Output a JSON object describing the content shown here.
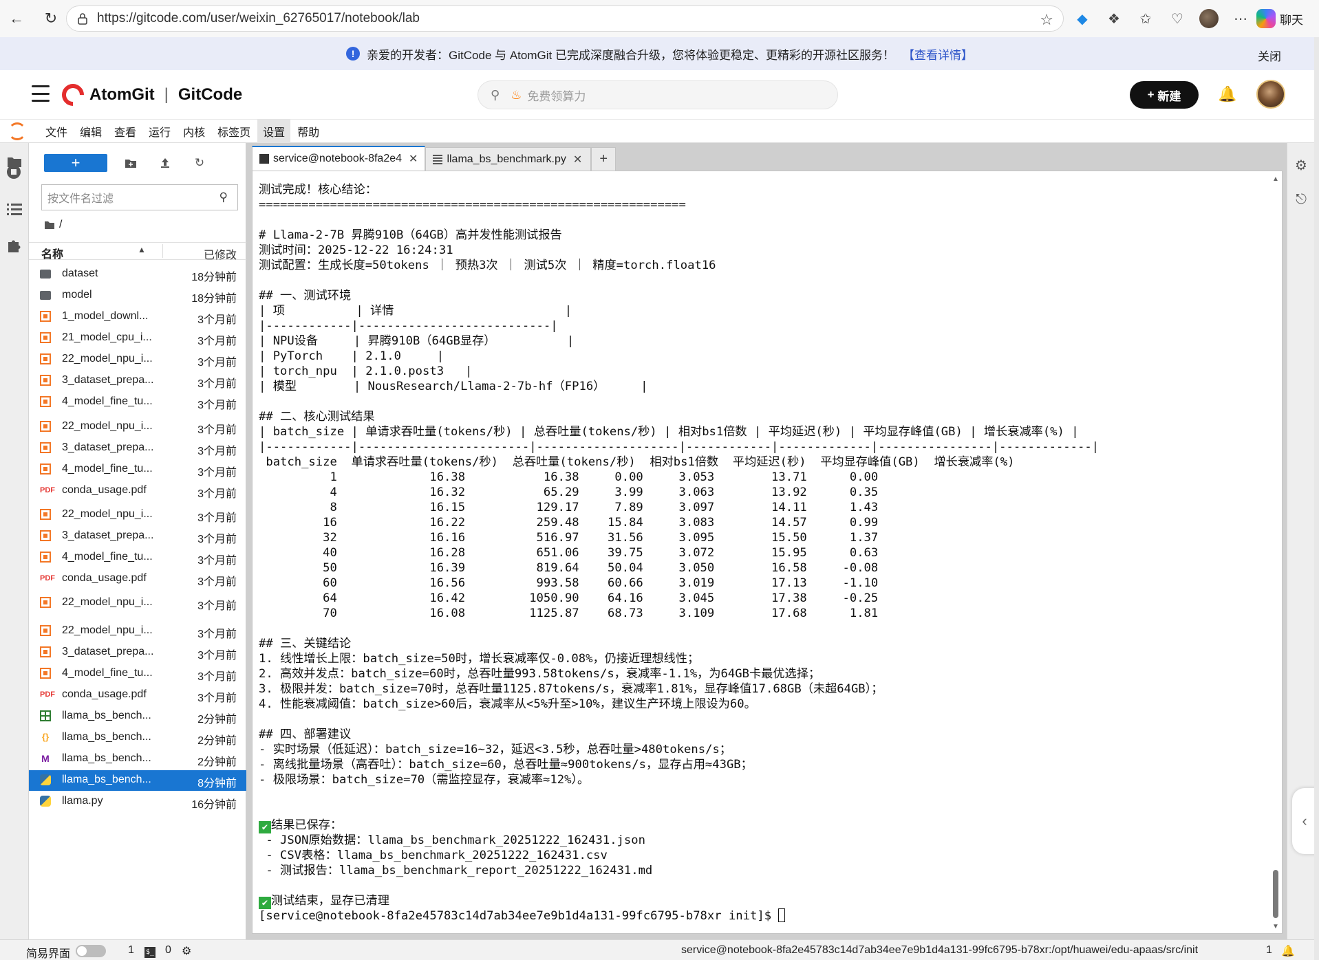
{
  "browser": {
    "url": "https://gitcode.com/user/weixin_62765017/notebook/lab",
    "chat_label": "聊天"
  },
  "notice": {
    "text": "亲爱的开发者：GitCode 与 AtomGit 已完成深度融合升级，您将体验更稳定、更精彩的开源社区服务！",
    "link": "【查看详情】",
    "close": "关闭"
  },
  "header": {
    "brand_left": "AtomGit",
    "brand_sep": "|",
    "brand_right": "GitCode",
    "search_placeholder": "免费领算力",
    "new_label": "新建"
  },
  "menubar": {
    "items": [
      "文件",
      "编辑",
      "查看",
      "运行",
      "内核",
      "标签页",
      "设置",
      "帮助"
    ],
    "active": "设置"
  },
  "filebrowser": {
    "filter_placeholder": "按文件名过滤",
    "path": "/",
    "col_name": "名称",
    "col_modified": "已修改",
    "files": [
      {
        "name": "dataset",
        "type": "folder",
        "modified": "18分钟前"
      },
      {
        "name": "model",
        "type": "folder",
        "modified": "18分钟前"
      },
      {
        "name": "1_model_downl...",
        "type": "notebook",
        "modified": "3个月前"
      },
      {
        "name": "21_model_cpu_i...",
        "type": "notebook",
        "modified": "3个月前"
      },
      {
        "name": "22_model_npu_i...",
        "type": "notebook",
        "modified": "3个月前"
      },
      {
        "name": "3_dataset_prepa...",
        "type": "notebook",
        "modified": "3个月前"
      },
      {
        "name": "4_model_fine_tu...",
        "type": "notebook",
        "modified": "3个月前"
      },
      {
        "name": "22_model_npu_i...",
        "type": "notebook",
        "modified": "3个月前"
      },
      {
        "name": "3_dataset_prepa...",
        "type": "notebook",
        "modified": "3个月前"
      },
      {
        "name": "4_model_fine_tu...",
        "type": "notebook",
        "modified": "3个月前"
      },
      {
        "name": "conda_usage.pdf",
        "type": "pdf",
        "modified": "3个月前"
      },
      {
        "name": "22_model_npu_i...",
        "type": "notebook",
        "modified": "3个月前"
      },
      {
        "name": "3_dataset_prepa...",
        "type": "notebook",
        "modified": "3个月前"
      },
      {
        "name": "4_model_fine_tu...",
        "type": "notebook",
        "modified": "3个月前"
      },
      {
        "name": "conda_usage.pdf",
        "type": "pdf",
        "modified": "3个月前"
      },
      {
        "name": "22_model_npu_i...",
        "type": "notebook",
        "modified": "3个月前"
      },
      {
        "name": "22_model_npu_i...",
        "type": "notebook",
        "modified": "3个月前"
      },
      {
        "name": "3_dataset_prepa...",
        "type": "notebook",
        "modified": "3个月前"
      },
      {
        "name": "4_model_fine_tu...",
        "type": "notebook",
        "modified": "3个月前"
      },
      {
        "name": "conda_usage.pdf",
        "type": "pdf",
        "modified": "3个月前"
      },
      {
        "name": "llama_bs_bench...",
        "type": "csv",
        "modified": "2分钟前"
      },
      {
        "name": "llama_bs_bench...",
        "type": "json",
        "modified": "2分钟前"
      },
      {
        "name": "llama_bs_bench...",
        "type": "md",
        "modified": "2分钟前"
      },
      {
        "name": "llama_bs_bench...",
        "type": "py",
        "modified": "8分钟前",
        "selected": true
      },
      {
        "name": "llama.py",
        "type": "py",
        "modified": "16分钟前"
      }
    ]
  },
  "tabs": [
    {
      "label": "service@notebook-8fa2e4",
      "type": "terminal",
      "active": true
    },
    {
      "label": "llama_bs_benchmark.py",
      "type": "file",
      "active": false
    }
  ],
  "terminal": {
    "lines": [
      "测试完成！核心结论：",
      "============================================================",
      "",
      "# Llama-2-7B 昇腾910B（64GB）高并发性能测试报告",
      "测试时间：2025-12-22 16:24:31",
      "测试配置：生成长度=50tokens ｜ 预热3次 ｜ 测试5次 ｜ 精度=torch.float16",
      "",
      "## 一、测试环境",
      "| 项          | 详情                        |",
      "|------------|---------------------------|",
      "| NPU设备     | 昇腾910B（64GB显存）          |",
      "| PyTorch    | 2.1.0     |",
      "| torch_npu  | 2.1.0.post3   |",
      "| 模型        | NousResearch/Llama-2-7b-hf（FP16）     |",
      "",
      "## 二、核心测试结果",
      "| batch_size | 单请求吞吐量(tokens/秒) | 总吞吐量(tokens/秒) | 相对bs1倍数 | 平均延迟(秒) | 平均显存峰值(GB) | 增长衰减率(%) |",
      "|------------|------------------------|--------------------|------------|-------------|----------------|-------------|",
      " batch_size  单请求吞吐量(tokens/秒)  总吞吐量(tokens/秒)  相对bs1倍数  平均延迟(秒)  平均显存峰值(GB)  增长衰减率(%)",
      "          1             16.38           16.38     0.00     3.053        13.71      0.00",
      "          4             16.32           65.29     3.99     3.063        13.92      0.35",
      "          8             16.15          129.17     7.89     3.097        14.11      1.43",
      "         16             16.22          259.48    15.84     3.083        14.57      0.99",
      "         32             16.16          516.97    31.56     3.095        15.50      1.37",
      "         40             16.28          651.06    39.75     3.072        15.95      0.63",
      "         50             16.39          819.64    50.04     3.050        16.58     -0.08",
      "         60             16.56          993.58    60.66     3.019        17.13     -1.10",
      "         64             16.42         1050.90    64.16     3.045        17.38     -0.25",
      "         70             16.08         1125.87    68.73     3.109        17.68      1.81",
      "",
      "## 三、关键结论",
      "1. 线性增长上限：batch_size=50时，增长衰减率仅-0.08%，仍接近理想线性；",
      "2. 高效并发点：batch_size=60时，总吞吐量993.58tokens/s，衰减率-1.1%，为64GB卡最优选择；",
      "3. 极限并发：batch_size=70时，总吞吐量1125.87tokens/s，衰减率1.81%，显存峰值17.68GB（未超64GB）；",
      "4. 性能衰减阈值：batch_size>60后，衰减率从<5%升至>10%，建议生产环境上限设为60。",
      "",
      "## 四、部署建议",
      "- 实时场景（低延迟）：batch_size=16~32，延迟<3.5秒，总吞吐量>480tokens/s；",
      "- 离线批量场景（高吞吐）：batch_size=60，总吞吐量≈900tokens/s，显存占用≈43GB；",
      "- 极限场景：batch_size=70（需监控显存，衰减率≈12%）。",
      "",
      "",
      "结果已保存：",
      " - JSON原始数据：llama_bs_benchmark_20251222_162431.json",
      " - CSV表格：llama_bs_benchmark_20251222_162431.csv",
      " - 测试报告：llama_bs_benchmark_report_20251222_162431.md",
      "",
      "测试结束，显存已清理",
      "[service@notebook-8fa2e45783c14d7ab34ee7e9b1d4a131-99fc6795-b78xr init]$ "
    ],
    "check_lines": [
      42,
      47
    ],
    "cursor_line": 48
  },
  "statusbar": {
    "simple_mode": "简易界面",
    "count_a": "1",
    "count_b": "0",
    "path": "service@notebook-8fa2e45783c14d7ab34ee7e9b1d4a131-99fc6795-b78xr:/opt/huawei/edu-apaas/src/init",
    "count_c": "1"
  }
}
